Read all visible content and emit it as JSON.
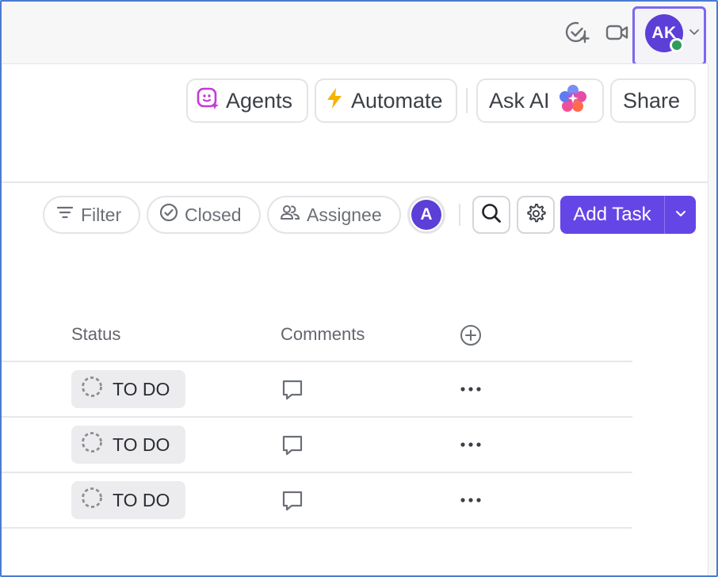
{
  "topbar": {
    "avatar_initials": "AK",
    "icons": [
      "check-circle-plus-icon",
      "video-camera-icon",
      "chevron-down-icon"
    ]
  },
  "actions": {
    "agents_label": "Agents",
    "automate_label": "Automate",
    "ask_ai_label": "Ask AI",
    "share_label": "Share"
  },
  "filters": {
    "filter_label": "Filter",
    "closed_label": "Closed",
    "assignee_label": "Assignee",
    "assignee_avatar_initial": "A",
    "add_task_label": "Add Task"
  },
  "table": {
    "columns": [
      "Status",
      "Comments"
    ],
    "rows": [
      {
        "status": "TO DO"
      },
      {
        "status": "TO DO"
      },
      {
        "status": "TO DO"
      }
    ]
  },
  "colors": {
    "accent": "#6446e6",
    "avatar": "#5b3fd6",
    "presence": "#2e9d5a",
    "agents_icon": "#c43ad8",
    "automate_icon": "#f5b400"
  }
}
